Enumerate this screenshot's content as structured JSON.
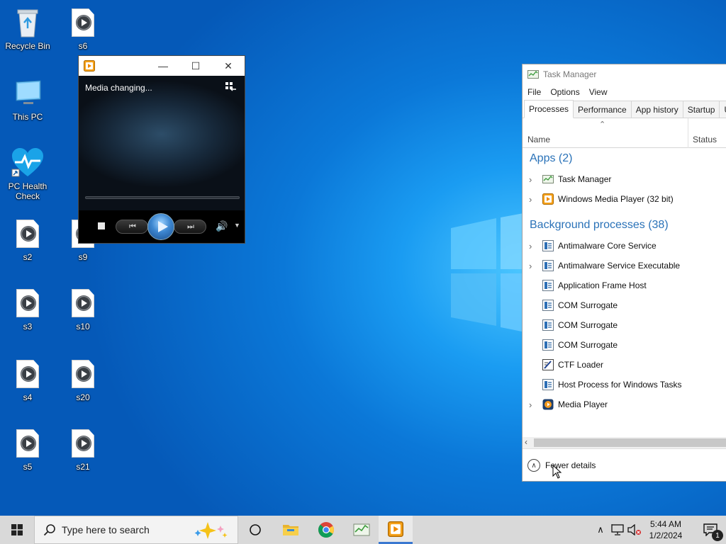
{
  "desktop": {
    "icons": [
      {
        "label": "Recycle Bin",
        "icon": "recycle-bin-icon"
      },
      {
        "label": "This PC",
        "icon": "computer-icon"
      },
      {
        "label": "PC Health Check",
        "icon": "health-heart-icon"
      },
      {
        "label": "s2",
        "icon": "media-file-icon"
      },
      {
        "label": "s3",
        "icon": "media-file-icon"
      },
      {
        "label": "s4",
        "icon": "media-file-icon"
      },
      {
        "label": "s5",
        "icon": "media-file-icon"
      },
      {
        "label": "s6",
        "icon": "media-file-icon"
      },
      {
        "label": "s9",
        "icon": "media-file-icon"
      },
      {
        "label": "s10",
        "icon": "media-file-icon"
      },
      {
        "label": "s20",
        "icon": "media-file-icon"
      },
      {
        "label": "s21",
        "icon": "media-file-icon"
      }
    ]
  },
  "media_player": {
    "status_text": "Media changing...",
    "icons": {
      "app": "media-player-icon",
      "minimize": "minimize-icon",
      "maximize": "maximize-icon",
      "close": "close-icon",
      "switch_view": "switch-to-library-icon",
      "stop": "stop-icon",
      "previous": "previous-icon",
      "play": "play-icon",
      "next": "next-icon",
      "volume": "volume-icon"
    }
  },
  "task_manager": {
    "title": "Task Manager",
    "menu": [
      "File",
      "Options",
      "View"
    ],
    "tabs": [
      "Processes",
      "Performance",
      "App history",
      "Startup",
      "Us"
    ],
    "active_tab": "Processes",
    "columns": {
      "name": "Name",
      "status": "Status"
    },
    "groups": {
      "apps": {
        "label": "Apps (2)",
        "items": [
          {
            "name": "Task Manager",
            "expandable": true,
            "icon": "task-manager-icon"
          },
          {
            "name": "Windows Media Player (32 bit)",
            "expandable": true,
            "icon": "media-player-icon"
          }
        ]
      },
      "background": {
        "label": "Background processes (38)",
        "items": [
          {
            "name": "Antimalware Core Service",
            "expandable": true,
            "icon": "service-icon"
          },
          {
            "name": "Antimalware Service Executable",
            "expandable": true,
            "icon": "service-icon"
          },
          {
            "name": "Application Frame Host",
            "expandable": false,
            "icon": "service-icon"
          },
          {
            "name": "COM Surrogate",
            "expandable": false,
            "icon": "service-icon"
          },
          {
            "name": "COM Surrogate",
            "expandable": false,
            "icon": "service-icon"
          },
          {
            "name": "COM Surrogate",
            "expandable": false,
            "icon": "service-icon"
          },
          {
            "name": "CTF Loader",
            "expandable": false,
            "icon": "ctf-loader-icon"
          },
          {
            "name": "Host Process for Windows Tasks",
            "expandable": false,
            "icon": "service-icon"
          },
          {
            "name": "Media Player",
            "expandable": true,
            "icon": "media-player-icon"
          }
        ]
      }
    },
    "fewer_details": "Fewer details"
  },
  "taskbar": {
    "search_placeholder": "Type here to search",
    "pinned": [
      "task-view-icon",
      "file-explorer-icon",
      "chrome-icon",
      "task-manager-icon",
      "media-player-icon"
    ],
    "tray_icons": [
      "chevron-up-icon",
      "network-icon",
      "volume-muted-icon"
    ],
    "time": "5:44 AM",
    "date": "1/2/2024",
    "notification_count": "1"
  },
  "colors": {
    "accent": "#2a72b8",
    "desktop_blue": "#0b78d8",
    "taskbar": "#d9d9d9"
  }
}
